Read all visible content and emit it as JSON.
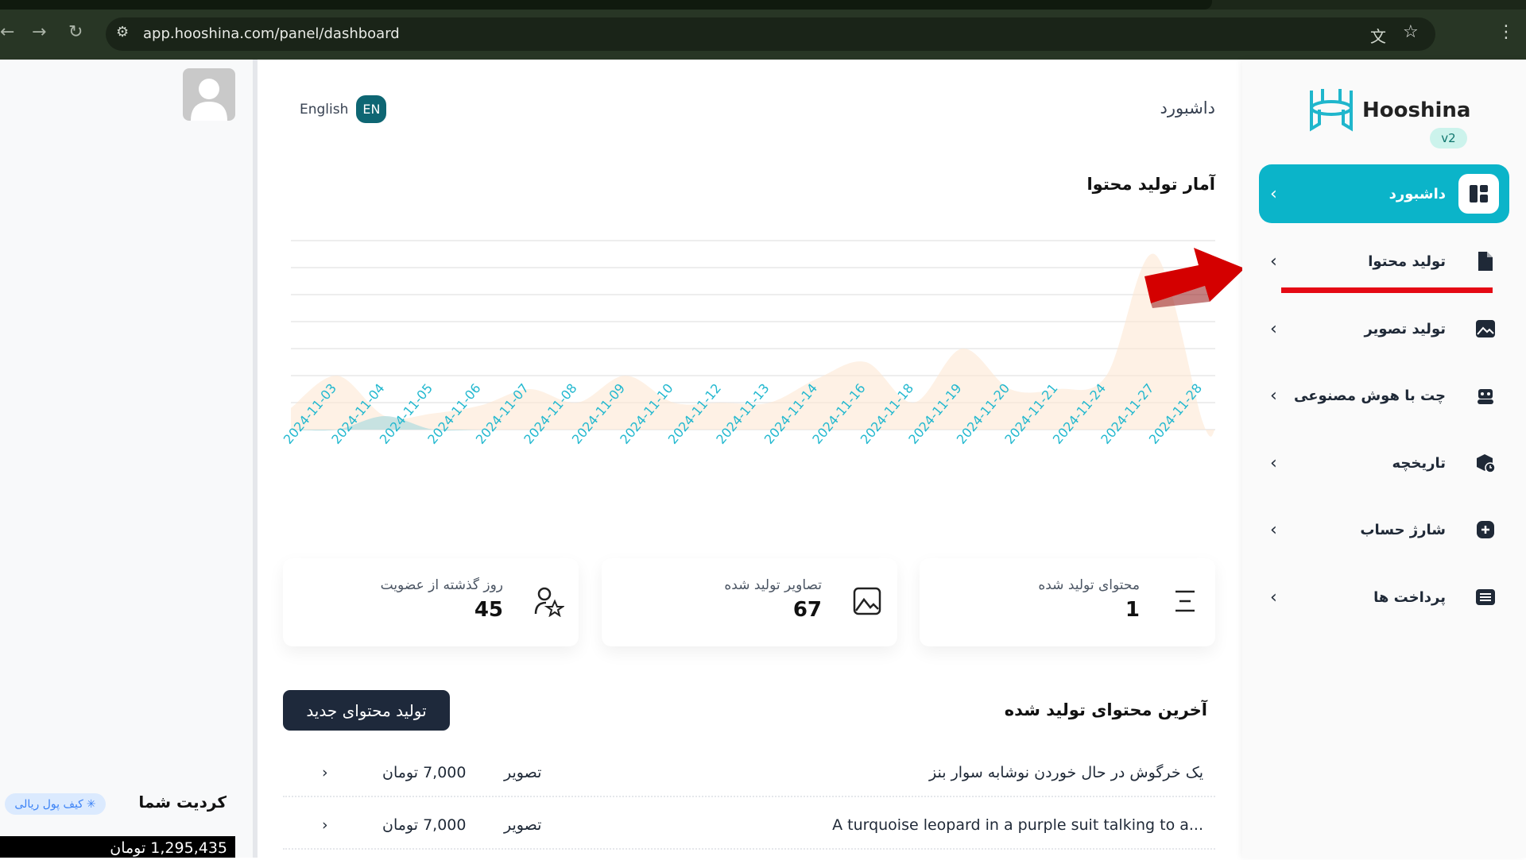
{
  "browser": {
    "url": "app.hooshina.com/panel/dashboard",
    "icons": [
      "back-icon",
      "forward-icon",
      "reload-icon",
      "site-settings-icon",
      "translate-icon",
      "star-icon",
      "more-icon"
    ]
  },
  "header": {
    "title": "داشبورد",
    "language_label": "English",
    "language_badge": "EN"
  },
  "chart": {
    "title": "آمار تولید محتوا"
  },
  "chart_data": {
    "type": "area",
    "title": "آمار تولید محتوا",
    "categories": [
      "2024-11-03",
      "2024-11-04",
      "2024-11-05",
      "2024-11-06",
      "2024-11-07",
      "2024-11-08",
      "2024-11-09",
      "2024-11-10",
      "2024-11-12",
      "2024-11-13",
      "2024-11-14",
      "2024-11-16",
      "2024-11-18",
      "2024-11-19",
      "2024-11-20",
      "2024-11-21",
      "2024-11-24",
      "2024-11-27",
      "2024-11-28"
    ],
    "series": [
      {
        "color": "#fde7d3",
        "values": [
          2,
          0.5,
          0.6,
          0.9,
          1.5,
          1,
          2,
          1,
          1,
          1,
          1.9,
          2.5,
          1,
          3,
          1.5,
          1.5,
          2,
          6.5,
          0.3
        ]
      },
      {
        "color": "#b9dfe0",
        "values": [
          0,
          0.5,
          0,
          0,
          0,
          0,
          0,
          0,
          0,
          0,
          0,
          0,
          0,
          0,
          0,
          0,
          0,
          0,
          0
        ]
      }
    ],
    "ylim": [
      0,
      7
    ],
    "grid": true,
    "tick_color": "#22b8cf"
  },
  "stats": [
    {
      "label": "محتوای تولید شده",
      "value": "1",
      "icon": "list-icon"
    },
    {
      "label": "تصاویر تولید شده",
      "value": "67",
      "icon": "image-icon"
    },
    {
      "label": "روز گذشته از عضویت",
      "value": "45",
      "icon": "user-star-icon"
    }
  ],
  "recent": {
    "title": "آخرین محتوای تولید شده",
    "new_button": "تولید محتوای جدید",
    "rows": [
      {
        "title": "یک خرگوش در حال خوردن نوشابه سوار بنز",
        "type": "تصویر",
        "price": "7,000 تومان"
      },
      {
        "title": "A turquoise leopard in a purple suit talking to a...",
        "type": "تصویر",
        "price": "7,000 تومان"
      }
    ]
  },
  "credit": {
    "title": "کردیت شما",
    "wallet_badge": "کیف پول ریالی",
    "balance": "1,295,435 تومان"
  },
  "sidebar": {
    "brand": "Hooshina",
    "version": "v2",
    "accent": "#0bb4c9",
    "items": [
      {
        "label": "داشبورد",
        "icon": "dashboard-icon",
        "active": true
      },
      {
        "label": "تولید محتوا",
        "icon": "file-icon"
      },
      {
        "label": "تولید تصویر",
        "icon": "image-icon"
      },
      {
        "label": "چت با هوش مصنوعی",
        "icon": "robot-icon"
      },
      {
        "label": "تاریخچه",
        "icon": "history-icon"
      },
      {
        "label": "شارژ حساب",
        "icon": "plus-icon"
      },
      {
        "label": "پرداخت ها",
        "icon": "list-icon"
      }
    ]
  }
}
